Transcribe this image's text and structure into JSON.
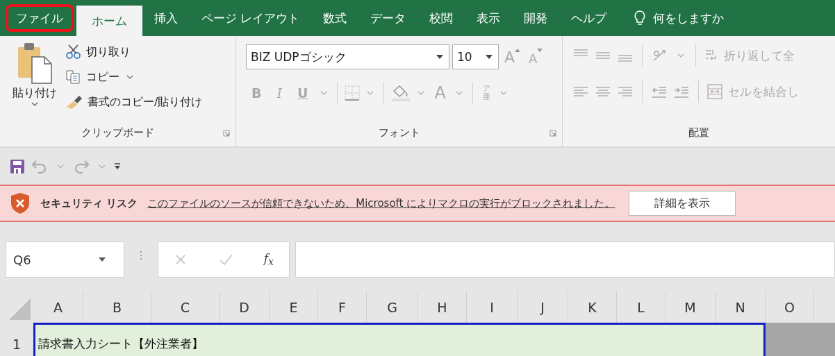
{
  "tabs": [
    {
      "label": "ファイル",
      "selected": false,
      "highlighted": true
    },
    {
      "label": "ホーム",
      "selected": true,
      "highlighted": false
    },
    {
      "label": "挿入",
      "selected": false,
      "highlighted": false
    },
    {
      "label": "ページ レイアウト",
      "selected": false,
      "highlighted": false
    },
    {
      "label": "数式",
      "selected": false,
      "highlighted": false
    },
    {
      "label": "データ",
      "selected": false,
      "highlighted": false
    },
    {
      "label": "校閲",
      "selected": false,
      "highlighted": false
    },
    {
      "label": "表示",
      "selected": false,
      "highlighted": false
    },
    {
      "label": "開発",
      "selected": false,
      "highlighted": false
    },
    {
      "label": "ヘルプ",
      "selected": false,
      "highlighted": false
    }
  ],
  "tell_me": {
    "label": "何をしますか"
  },
  "clipboard": {
    "title": "クリップボード",
    "paste": "貼り付け",
    "cut": "切り取り",
    "copy": "コピー",
    "format_painter": "書式のコピー/貼り付け"
  },
  "font": {
    "title": "フォント",
    "disabled": true,
    "font_name": "BIZ UDPゴシック",
    "font_size": "10",
    "grow": "A",
    "shrink": "A",
    "bold": "B",
    "italic": "I",
    "underline": "U",
    "font_color": "A",
    "phonetic_top": "ア",
    "phonetic_bottom": "亜"
  },
  "alignment": {
    "title": "配置",
    "disabled": true,
    "wrap_text": "折り返して全",
    "merge": "セルを結合し"
  },
  "quick_access": {
    "undo_disabled": true,
    "redo_disabled": true
  },
  "security_bar": {
    "title": "セキュリティ リスク",
    "message": "このファイルのソースが信頼できないため、Microsoft によりマクロの実行がブロックされました。",
    "button": "詳細を表示"
  },
  "formula_bar": {
    "name_box": "Q6",
    "function_label": "f$_{x}$"
  },
  "sheet": {
    "columns": [
      "A",
      "B",
      "C",
      "D",
      "E",
      "F",
      "G",
      "H",
      "I",
      "J",
      "K",
      "L",
      "M",
      "N",
      "O"
    ],
    "rows": [
      {
        "number": "1",
        "text": "請求書入力シート【外注業者】"
      }
    ]
  }
}
